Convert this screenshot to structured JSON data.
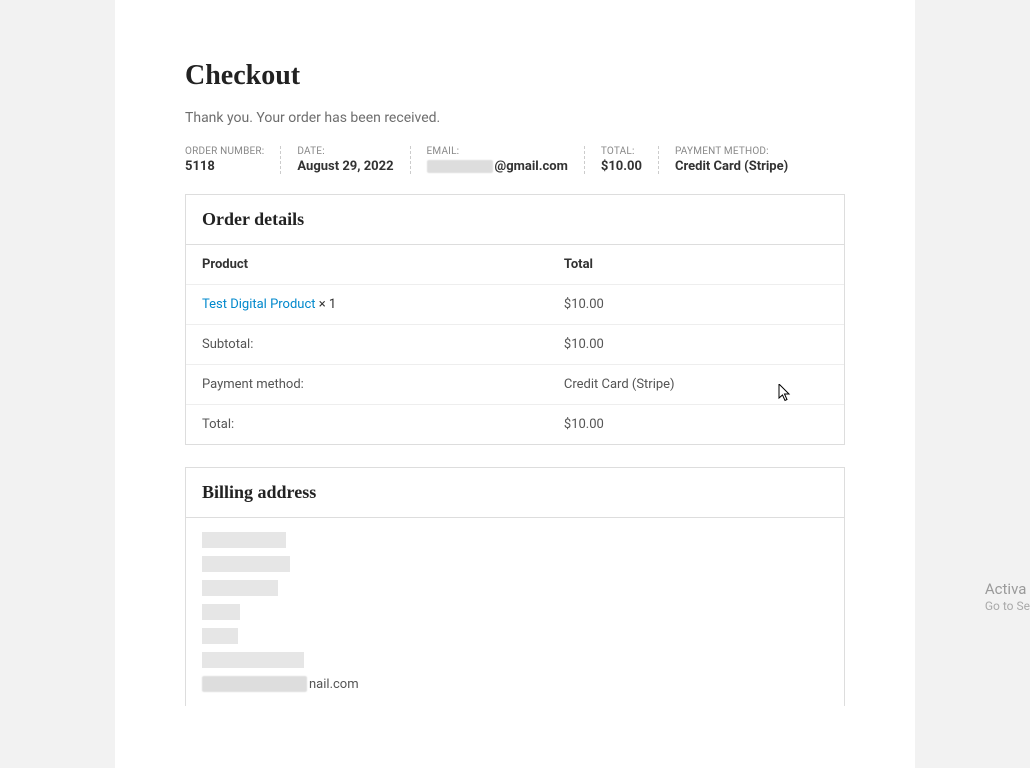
{
  "page": {
    "title": "Checkout",
    "thank_you": "Thank you. Your order has been received."
  },
  "meta": {
    "order_number_label": "ORDER NUMBER:",
    "order_number": "5118",
    "date_label": "DATE:",
    "date": "August 29, 2022",
    "email_label": "EMAIL:",
    "email_suffix": "@gmail.com",
    "total_label": "TOTAL:",
    "total": "$10.00",
    "payment_method_label": "PAYMENT METHOD:",
    "payment_method": "Credit Card (Stripe)"
  },
  "order_details": {
    "heading": "Order details",
    "header_product": "Product",
    "header_total": "Total",
    "rows": [
      {
        "product_name": "Test Digital Product",
        "qty": " × 1",
        "total": "$10.00"
      }
    ],
    "subtotal_label": "Subtotal:",
    "subtotal_value": "$10.00",
    "payment_method_label": "Payment method:",
    "payment_method_value": "Credit Card (Stripe)",
    "total_label": "Total:",
    "total_value": "$10.00"
  },
  "billing": {
    "heading": "Billing address",
    "email_suffix": "nail.com"
  },
  "watermark": {
    "line1": "Activa",
    "line2": "Go to Se"
  }
}
